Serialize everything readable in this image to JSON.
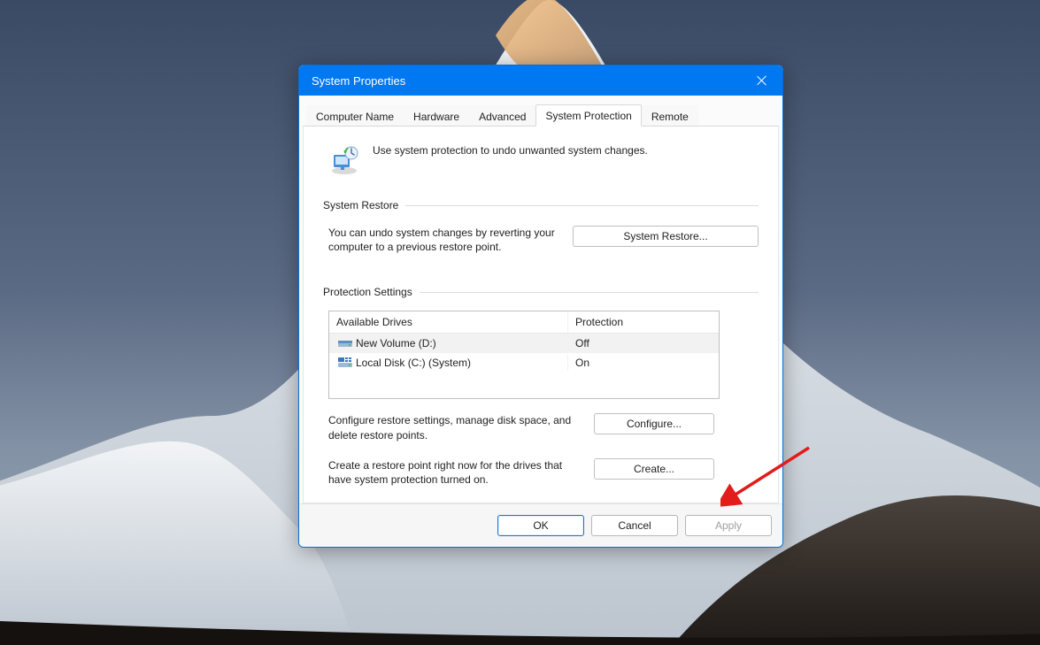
{
  "dialog": {
    "title": "System Properties",
    "tabs": [
      {
        "label": "Computer Name"
      },
      {
        "label": "Hardware"
      },
      {
        "label": "Advanced"
      },
      {
        "label": "System Protection",
        "active": true
      },
      {
        "label": "Remote"
      }
    ],
    "intro_text": "Use system protection to undo unwanted system changes.",
    "groups": {
      "restore": {
        "title": "System Restore",
        "desc": "You can undo system changes by reverting your computer to a previous restore point.",
        "button": "System Restore..."
      },
      "settings": {
        "title": "Protection Settings",
        "columns": {
          "drives": "Available Drives",
          "protection": "Protection"
        },
        "rows": [
          {
            "icon": "drive-icon",
            "name": "New Volume (D:)",
            "protection": "Off",
            "selected": true
          },
          {
            "icon": "drive-icon",
            "name": "Local Disk (C:) (System)",
            "protection": "On",
            "selected": false
          }
        ],
        "configure_desc": "Configure restore settings, manage disk space, and delete restore points.",
        "configure_button": "Configure...",
        "create_desc": "Create a restore point right now for the drives that have system protection turned on.",
        "create_button": "Create..."
      }
    },
    "footer": {
      "ok": "OK",
      "cancel": "Cancel",
      "apply": "Apply"
    }
  },
  "annotation": {
    "arrow_points_to": "create-button",
    "color": "#e21b1b"
  }
}
